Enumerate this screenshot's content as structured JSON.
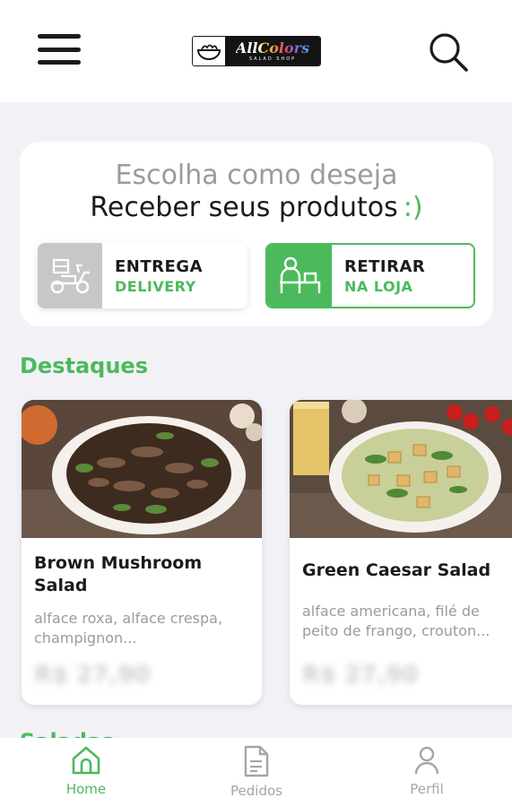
{
  "header": {
    "logo": {
      "brand": "AllColors",
      "tagline": "SALAD SHOP"
    },
    "menu_icon": "hamburger-icon",
    "search_icon": "search-icon"
  },
  "choice": {
    "title": "Escolha como deseja",
    "subtitle": "Receber seus produtos",
    "smile": ":)",
    "options": [
      {
        "main": "ENTREGA",
        "second": "DELIVERY",
        "icon": "scooter-icon",
        "selected": false
      },
      {
        "main": "RETIRAR",
        "second": "NA LOJA",
        "icon": "store-pickup-icon",
        "selected": true
      }
    ]
  },
  "highlights": {
    "title": "Destaques",
    "products": [
      {
        "name": "Brown Mushroom Salad",
        "description": "alface roxa, alface crespa, champignon...",
        "price": "R$ 27,90"
      },
      {
        "name": "Green Caesar Salad",
        "description": "alface americana, filé de peito de frango, crouton...",
        "price": "R$ 27,90"
      }
    ]
  },
  "next_section": {
    "title": "Saladas"
  },
  "bottom_nav": {
    "items": [
      {
        "label": "Home",
        "icon": "home-icon",
        "active": true
      },
      {
        "label": "Pedidos",
        "icon": "document-icon",
        "active": false
      },
      {
        "label": "Perfil",
        "icon": "user-icon",
        "active": false
      }
    ]
  },
  "colors": {
    "accent": "#4cba5c",
    "background": "#f2f2f6",
    "muted_text": "#9b9b9b"
  }
}
